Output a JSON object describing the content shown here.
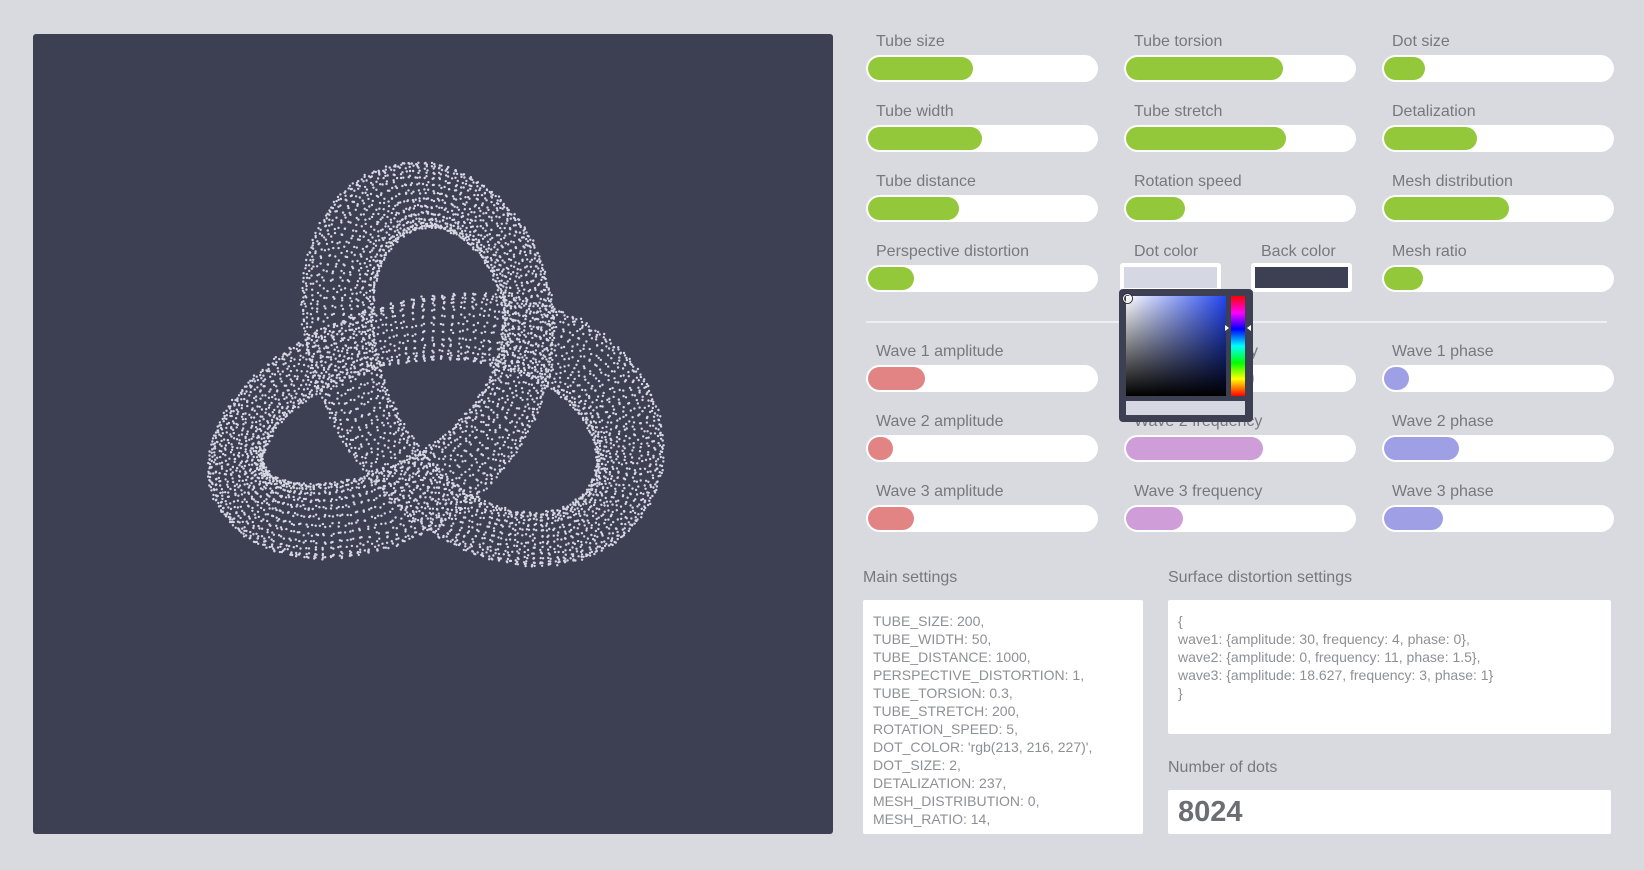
{
  "colors": {
    "page_bg": "#d9dae0",
    "canvas_bg": "#3d3f53",
    "dot_color": "rgb(213, 216, 227)",
    "green": "#93c83a",
    "red": "#e28384",
    "pink": "#cf9ed9",
    "purple": "#9f9fe6",
    "back_color": "#3d3f53"
  },
  "controls": {
    "tube_size": {
      "label": "Tube size",
      "value": 0.46
    },
    "tube_torsion": {
      "label": "Tube torsion",
      "value": 0.69
    },
    "dot_size": {
      "label": "Dot size",
      "value": 0.18
    },
    "tube_width": {
      "label": "Tube width",
      "value": 0.5
    },
    "tube_stretch": {
      "label": "Tube stretch",
      "value": 0.7
    },
    "detalization": {
      "label": "Detalization",
      "value": 0.41
    },
    "tube_distance": {
      "label": "Tube distance",
      "value": 0.4
    },
    "rotation_speed": {
      "label": "Rotation speed",
      "value": 0.26
    },
    "mesh_distribution": {
      "label": "Mesh distribution",
      "value": 0.55
    },
    "perspective_distortion": {
      "label": "Perspective distortion",
      "value": 0.2
    },
    "dot_color": {
      "label": "Dot color"
    },
    "back_color": {
      "label": "Back color"
    },
    "mesh_ratio": {
      "label": "Mesh ratio",
      "value": 0.17
    },
    "wave1_amplitude": {
      "label": "Wave 1 amplitude",
      "value": 0.25
    },
    "wave1_frequency": {
      "label": "cy",
      "value": 0.56
    },
    "wave1_phase": {
      "label": "Wave 1 phase",
      "value": 0.11
    },
    "wave2_amplitude": {
      "label": "Wave 2 amplitude",
      "value": 0.11
    },
    "wave2_frequency": {
      "label": "Wave 2 frequency",
      "value": 0.6
    },
    "wave2_phase": {
      "label": "Wave 2 phase",
      "value": 0.33
    },
    "wave3_amplitude": {
      "label": "Wave 3 amplitude",
      "value": 0.2
    },
    "wave3_frequency": {
      "label": "Wave 3 frequency",
      "value": 0.25
    },
    "wave3_phase": {
      "label": "Wave 3 phase",
      "value": 0.26
    }
  },
  "sections": {
    "main_settings_title": "Main settings",
    "main_settings_text": "TUBE_SIZE: 200,\nTUBE_WIDTH: 50,\nTUBE_DISTANCE: 1000,\nPERSPECTIVE_DISTORTION: 1,\nTUBE_TORSION: 0.3,\nTUBE_STRETCH: 200,\nROTATION_SPEED: 5,\nDOT_COLOR: 'rgb(213, 216, 227)',\nDOT_SIZE: 2,\nDETALIZATION: 237,\nMESH_DISTRIBUTION: 0,\nMESH_RATIO: 14,",
    "surface_title": "Surface distortion settings",
    "surface_text": "{\nwave1: {amplitude: 30, frequency: 4, phase: 0},\nwave2: {amplitude: 0, frequency: 11, phase: 1.5},\nwave3: {amplitude: 18.627, frequency: 3, phase: 1}\n}",
    "dots_title": "Number of dots",
    "dots_value": "8024"
  }
}
